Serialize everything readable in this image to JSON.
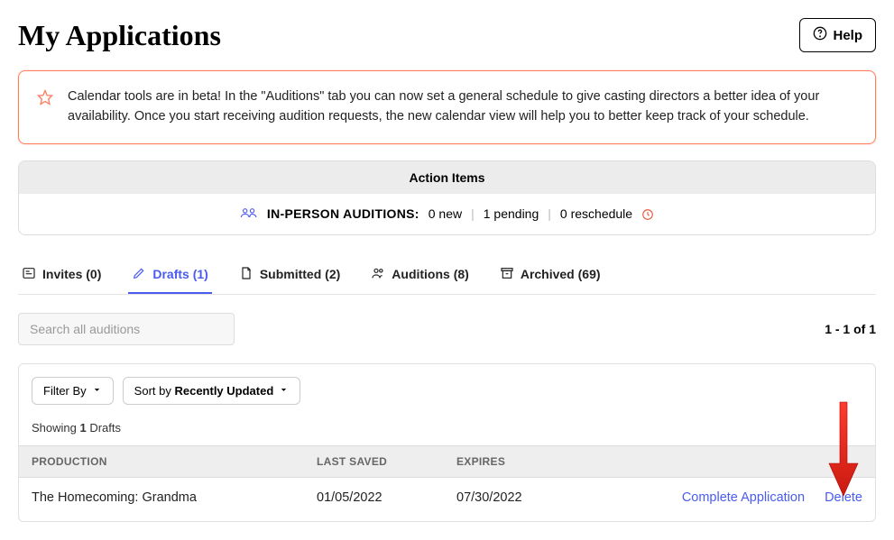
{
  "header": {
    "title": "My Applications",
    "help_label": "Help"
  },
  "banner": {
    "text": "Calendar tools are in beta! In the \"Auditions\" tab you can now set a general schedule to give casting directors a better idea of your availability. Once you start receiving audition requests, the new calendar view will help you to better keep track of your schedule."
  },
  "action_items": {
    "header": "Action Items",
    "label": "IN-PERSON AUDITIONS:",
    "new_text": "0 new",
    "pending_text": "1 pending",
    "reschedule_text": "0 reschedule"
  },
  "tabs": {
    "invites": "Invites (0)",
    "drafts": "Drafts (1)",
    "submitted": "Submitted (2)",
    "auditions": "Auditions (8)",
    "archived": "Archived (69)"
  },
  "search": {
    "placeholder": "Search all auditions"
  },
  "pagination": {
    "text": "1 - 1 of 1"
  },
  "filters": {
    "filter_by_label": "Filter By",
    "sort_prefix": "Sort by ",
    "sort_value": "Recently Updated"
  },
  "showing": {
    "prefix": "Showing ",
    "count": "1",
    "suffix": " Drafts"
  },
  "table": {
    "headers": {
      "production": "PRODUCTION",
      "last_saved": "LAST SAVED",
      "expires": "EXPIRES"
    },
    "rows": [
      {
        "production": "The Homecoming: Grandma",
        "last_saved": "01/05/2022",
        "expires": "07/30/2022",
        "complete_label": "Complete Application",
        "delete_label": "Delete"
      }
    ]
  }
}
